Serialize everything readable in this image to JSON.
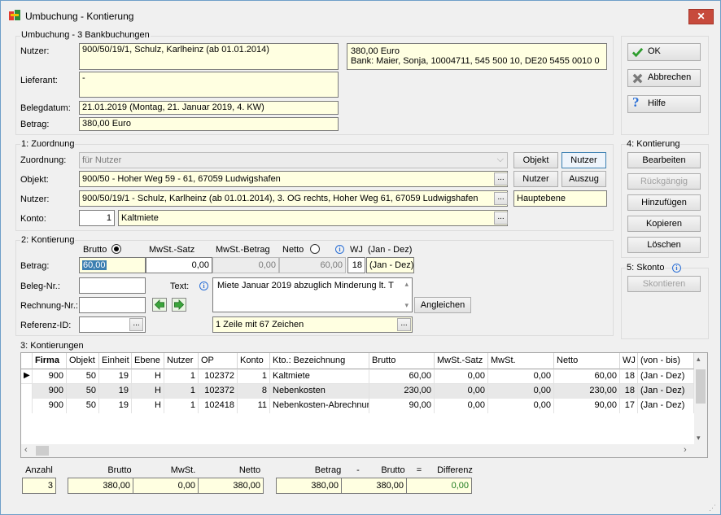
{
  "window": {
    "title": "Umbuchung - Kontierung",
    "close_glyph": "✕"
  },
  "umbuchung": {
    "heading": "Umbuchung - 3 Bankbuchungen",
    "nutzer_label": "Nutzer:",
    "nutzer_value": "900/50/19/1,  Schulz, Karlheinz  (ab 01.01.2014)",
    "info_amount": "380,00  Euro",
    "info_bank": "Bank: Maier, Sonja,  10004711,  545 500 10,  DE20 5455 0010 0",
    "lieferant_label": "Lieferant:",
    "lieferant_value": "-",
    "belegdatum_label": "Belegdatum:",
    "belegdatum_value": "21.01.2019  (Montag,  21. Januar 2019,  4. KW)",
    "betrag_label": "Betrag:",
    "betrag_value": "380,00  Euro"
  },
  "side": {
    "ok": "OK",
    "abbrechen": "Abbrechen",
    "hilfe": "Hilfe",
    "kontierung_heading": "4: Kontierung",
    "bearbeiten": "Bearbeiten",
    "rueckgaengig": "Rückgängig",
    "hinzufuegen": "Hinzufügen",
    "kopieren": "Kopieren",
    "loeschen": "Löschen",
    "skonto_heading": "5: Skonto",
    "skontieren": "Skontieren"
  },
  "zuordnung": {
    "heading": "1: Zuordnung",
    "zuordnung_label": "Zuordnung:",
    "zuordnung_value": "für Nutzer",
    "objekt_btn": "Objekt",
    "nutzer_btn": "Nutzer",
    "objekt_label": "Objekt:",
    "objekt_value": "900/50 - Hoher Weg 59 - 61, 67059 Ludwigshafen",
    "nutzer_btn2": "Nutzer",
    "auszug_btn": "Auszug",
    "nutzer_label": "Nutzer:",
    "nutzer_value": "900/50/19/1 - Schulz, Karlheinz  (ab 01.01.2014), 3. OG rechts, Hoher Weg 61, 67059 Ludwigshafen",
    "ebene_value": "Hauptebene",
    "konto_label": "Konto:",
    "konto_number": "1",
    "konto_value": "Kaltmiete",
    "ellipsis": "..."
  },
  "kontierung": {
    "heading": "2: Kontierung",
    "brutto_hdr": "Brutto",
    "mwst_satz_hdr": "MwSt.-Satz",
    "mwst_betrag_hdr": "MwSt.-Betrag",
    "netto_hdr": "Netto",
    "info_glyph": "i",
    "wj_hdr": "WJ",
    "wj_range_hdr": "(Jan - Dez)",
    "betrag_label": "Betrag:",
    "brutto_value": "60,00",
    "mwst_satz_value": "0,00",
    "mwst_betrag_value": "0,00",
    "netto_value": "60,00",
    "wj_value": "18",
    "wj_range_value": "(Jan - Dez)",
    "beleg_label": "Beleg-Nr.:",
    "text_label": "Text:",
    "text_value": "Miete Januar 2019 abzuglich Minderung lt. T",
    "rechnung_label": "Rechnung-Nr.:",
    "angleichen_btn": "Angleichen",
    "referenz_label": "Referenz-ID:",
    "text_info": "1 Zeile mit 67 Zeichen"
  },
  "kontierungen": {
    "heading": "3: Kontierungen",
    "columns": [
      "Firma",
      "Objekt",
      "Einheit",
      "Ebene",
      "Nutzer",
      "OP",
      "Konto",
      "Kto.: Bezeichnung",
      "Brutto",
      "MwSt.-Satz",
      "MwSt.",
      "Netto",
      "WJ",
      "(von - bis)"
    ],
    "rows": [
      [
        "900",
        "50",
        "19",
        "H",
        "1",
        "102372",
        "1",
        "Kaltmiete",
        "60,00",
        "0,00",
        "0,00",
        "60,00",
        "18",
        "(Jan - Dez)"
      ],
      [
        "900",
        "50",
        "19",
        "H",
        "1",
        "102372",
        "8",
        "Nebenkosten",
        "230,00",
        "0,00",
        "0,00",
        "230,00",
        "18",
        "(Jan - Dez)"
      ],
      [
        "900",
        "50",
        "19",
        "H",
        "1",
        "102418",
        "11",
        "Nebenkosten-Abrechnur",
        "90,00",
        "0,00",
        "0,00",
        "90,00",
        "17",
        "(Jan - Dez)"
      ]
    ]
  },
  "summary": {
    "anzahl_label": "Anzahl",
    "brutto_label": "Brutto",
    "mwst_label": "MwSt.",
    "netto_label": "Netto",
    "betrag_label": "Betrag",
    "minus": "-",
    "brutto2_label": "Brutto",
    "equals": "=",
    "differenz_label": "Differenz",
    "anzahl": "3",
    "brutto": "380,00",
    "mwst": "0,00",
    "netto": "380,00",
    "betrag": "380,00",
    "brutto2": "380,00",
    "differenz": "0,00"
  },
  "colors": {
    "accent": "#3c7fb1",
    "field_bg": "#ffffe1",
    "close": "#c74a3c",
    "ok_green": "#2e9d2e",
    "differenz": "#1e7a1e"
  }
}
